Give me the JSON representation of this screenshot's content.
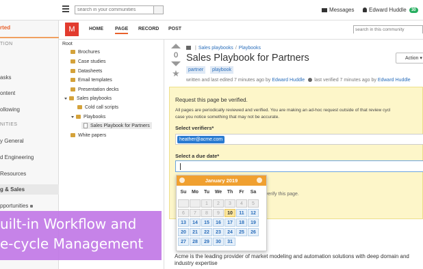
{
  "topbar": {
    "search_placeholder": "search in your communities",
    "messages_label": "Messages",
    "user_name": "Edward Huddle",
    "user_badge": "30"
  },
  "left_nav": {
    "started": "rted",
    "items": [
      {
        "label": "TION"
      },
      {
        "label": "asks"
      },
      {
        "label": "ontent"
      },
      {
        "label": "ollowing"
      },
      {
        "label": "NITIES"
      },
      {
        "label": "y General"
      },
      {
        "label": "d Engineering"
      },
      {
        "label": "Resources"
      },
      {
        "label": "g & Sales"
      },
      {
        "label": "pportunities"
      }
    ]
  },
  "community": {
    "logo_letter": "M",
    "tabs": [
      "HOME",
      "PAGE",
      "RECORD",
      "POST"
    ],
    "search_placeholder": "search in this community"
  },
  "tree": {
    "root": "Root",
    "items": [
      {
        "label": "Brochures"
      },
      {
        "label": "Case studies"
      },
      {
        "label": "Datasheets"
      },
      {
        "label": "Email templates"
      },
      {
        "label": "Presentation decks"
      },
      {
        "label": "Sales playbooks"
      },
      {
        "label": "Cold call scripts"
      },
      {
        "label": "Playbooks"
      },
      {
        "label": "Sales Playbook for Partners"
      },
      {
        "label": "White papers"
      }
    ]
  },
  "page": {
    "vote_count": "0",
    "breadcrumb": [
      "Sales playbooks",
      "Playbooks"
    ],
    "title": "Sales Playbook for Partners",
    "action_label": "Action",
    "tags": [
      "partner",
      "playbook"
    ],
    "meta_prefix": "written and last edited 7 minutes ago by",
    "meta_author": "Edward Huddle",
    "meta_verified": "last verified 7 minutes ago by",
    "meta_verifier": "Edward Huddle"
  },
  "verification": {
    "title": "Request this page be verified.",
    "body_line1": "All pages are periodically reviewed and verified. You are making an ad-hoc request outside of that review cycl",
    "body_line2": "case you notice something that may not be accurate.",
    "verifiers_label": "Select verifiers*",
    "verifier_chip": "heather@acme.com",
    "due_label": "Select a due date*",
    "note": "o verify this page."
  },
  "calendar": {
    "month": "January 2019",
    "weekdays": [
      "Su",
      "Mo",
      "Tu",
      "We",
      "Th",
      "Fr",
      "Sa"
    ],
    "days": [
      {
        "d": "",
        "s": "disabled"
      },
      {
        "d": "",
        "s": "disabled"
      },
      {
        "d": "1",
        "s": "disabled"
      },
      {
        "d": "2",
        "s": "disabled"
      },
      {
        "d": "3",
        "s": "disabled"
      },
      {
        "d": "4",
        "s": "disabled"
      },
      {
        "d": "5",
        "s": "disabled"
      },
      {
        "d": "6",
        "s": "disabled"
      },
      {
        "d": "7",
        "s": "disabled"
      },
      {
        "d": "8",
        "s": "disabled"
      },
      {
        "d": "9",
        "s": "disabled"
      },
      {
        "d": "10",
        "s": "today"
      },
      {
        "d": "11",
        "s": "enabled"
      },
      {
        "d": "12",
        "s": "enabled"
      },
      {
        "d": "13",
        "s": "enabled"
      },
      {
        "d": "14",
        "s": "enabled"
      },
      {
        "d": "15",
        "s": "enabled"
      },
      {
        "d": "16",
        "s": "enabled"
      },
      {
        "d": "17",
        "s": "enabled"
      },
      {
        "d": "18",
        "s": "enabled"
      },
      {
        "d": "19",
        "s": "enabled"
      },
      {
        "d": "20",
        "s": "enabled"
      },
      {
        "d": "21",
        "s": "enabled"
      },
      {
        "d": "22",
        "s": "enabled"
      },
      {
        "d": "23",
        "s": "enabled"
      },
      {
        "d": "24",
        "s": "enabled"
      },
      {
        "d": "25",
        "s": "enabled"
      },
      {
        "d": "26",
        "s": "enabled"
      },
      {
        "d": "27",
        "s": "enabled"
      },
      {
        "d": "28",
        "s": "enabled"
      },
      {
        "d": "29",
        "s": "enabled"
      },
      {
        "d": "30",
        "s": "enabled"
      },
      {
        "d": "31",
        "s": "enabled"
      }
    ]
  },
  "description": "Acme is the leading provider of market modeling and automation solutions with deep domain and industry expertise",
  "promo": {
    "line1": "uilt-in Workflow and",
    "line2": "e-cycle Management"
  },
  "colors": {
    "accent": "#e8612c",
    "link": "#2a6ebb",
    "panel": "#fdf6c9",
    "calendar_header": "#f0a030",
    "promo": "#c076e6"
  }
}
